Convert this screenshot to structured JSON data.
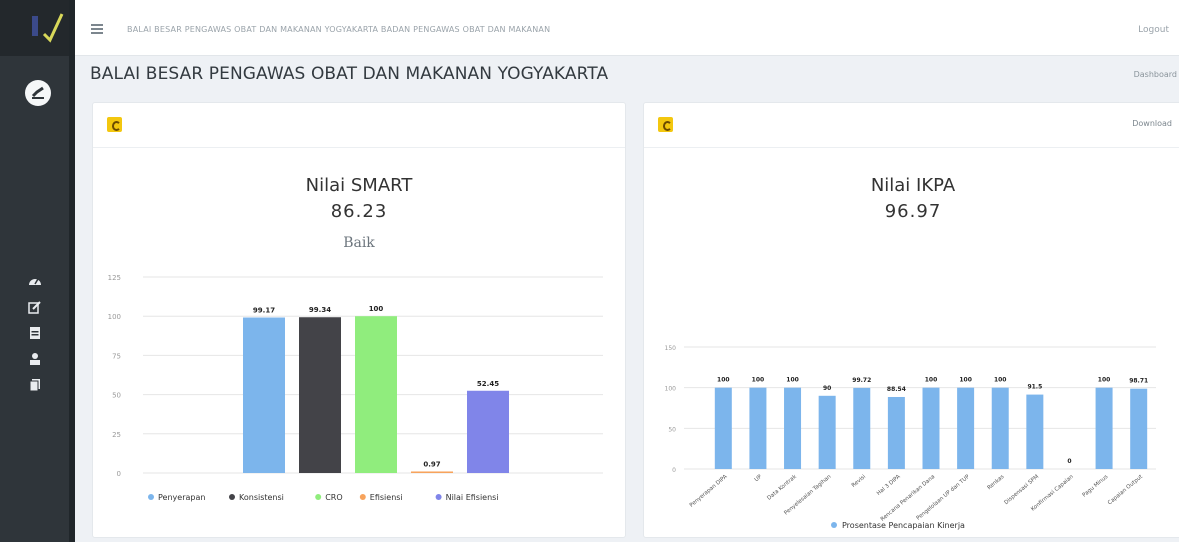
{
  "header": {
    "breadcrumb": "BALAI BESAR PENGAWAS OBAT DAN MAKANAN YOGYAKARTA BADAN PENGAWAS OBAT DAN MAKANAN",
    "logout_label": "Logout"
  },
  "page": {
    "title": "BALAI BESAR PENGAWAS OBAT DAN MAKANAN YOGYAKARTA",
    "crumb": "Dashboard"
  },
  "colors": {
    "sidebar": "#2f353a",
    "badge": "#f3c70f",
    "penyerapan": "#7cb5ec",
    "konsistensi": "#434348",
    "cro": "#90ed7d",
    "efisiensi": "#f7a35c",
    "nilai_efisiensi": "#8085e9",
    "ikpa": "#7cb5ec"
  },
  "sidebar": {
    "icons": [
      "dashboard-icon",
      "edit-icon",
      "calendar-icon",
      "user-icon",
      "copy-icon"
    ]
  },
  "smart": {
    "title": "Nilai SMART",
    "score": "86.23",
    "note": "Baik"
  },
  "ikpa": {
    "title": "Nilai IKPA",
    "score": "96.97",
    "link": "Download"
  },
  "chart_data": [
    {
      "type": "bar",
      "title": "Nilai SMART",
      "ylim": [
        0,
        125
      ],
      "yticks": [
        "0",
        "25",
        "50",
        "75",
        "100",
        "125"
      ],
      "grid": true,
      "legend": "bottom",
      "series": [
        {
          "name": "Penyerapan",
          "values": [
            99.17
          ],
          "labels": [
            "99.17"
          ]
        },
        {
          "name": "Konsistensi",
          "values": [
            99.34
          ],
          "labels": [
            "99.34"
          ]
        },
        {
          "name": "CRO",
          "values": [
            100
          ],
          "labels": [
            "100"
          ]
        },
        {
          "name": "Efisiensi",
          "values": [
            0.97
          ],
          "labels": [
            "0.97"
          ]
        },
        {
          "name": "Nilai Efisiensi",
          "values": [
            52.45
          ],
          "labels": [
            "52.45"
          ]
        }
      ]
    },
    {
      "type": "bar",
      "title": "Nilai IKPA",
      "ylim": [
        0,
        150
      ],
      "yticks": [
        "0",
        "50",
        "100",
        "150"
      ],
      "grid": true,
      "legend": "bottom",
      "categories": [
        "Penyerapan DIPA",
        "UP",
        "Data Kontrak",
        "Penyelesaian Tagihan",
        "Revisi",
        "Hal 3 DIPA",
        "Rencana Penarikan Dana",
        "Pengelolaan UP dan TUP",
        "Renkas",
        "Dispensasi SPM",
        "Konfirmasi Capaian",
        "Pagu Minus",
        "Capaian Output"
      ],
      "series": [
        {
          "name": "Prosentase Pencapaian Kinerja",
          "values": [
            100,
            100,
            100,
            90,
            99.72,
            88.54,
            100,
            100,
            100,
            91.5,
            0,
            100,
            98.71
          ],
          "labels": [
            "100",
            "100",
            "100",
            "90",
            "99.72",
            "88.54",
            "100",
            "100",
            "100",
            "91.5",
            "0",
            "100",
            "98.71"
          ]
        }
      ]
    }
  ]
}
